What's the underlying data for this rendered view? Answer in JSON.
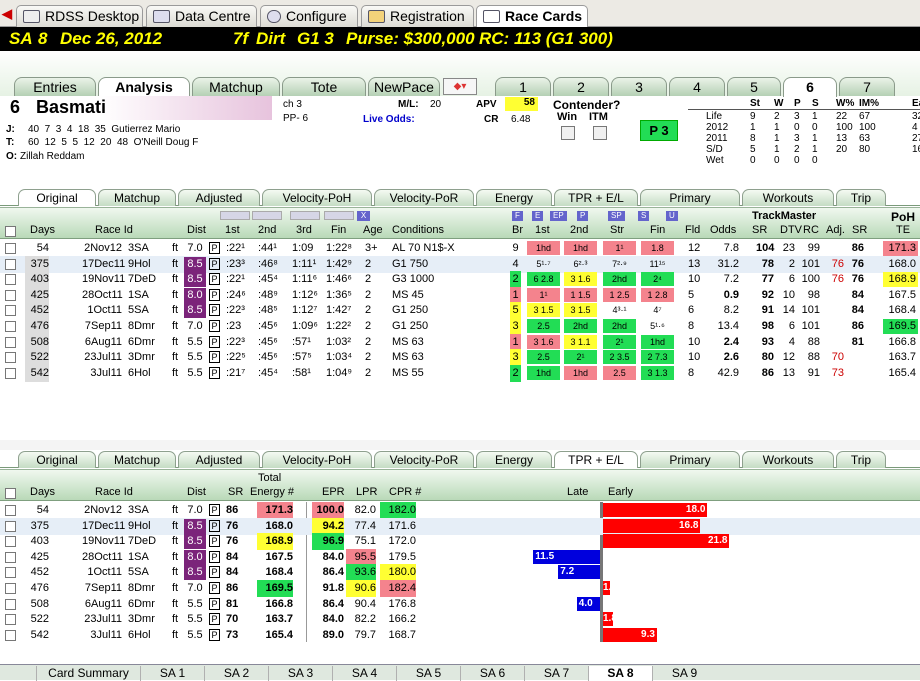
{
  "top_tabs": [
    {
      "label": "RDSS Desktop"
    },
    {
      "label": "Data Centre"
    },
    {
      "label": "Configure"
    },
    {
      "label": "Registration"
    },
    {
      "label": "Race Cards"
    }
  ],
  "race": {
    "track": "SA",
    "num": "8",
    "date": "Dec 26, 2012",
    "dist": "7f",
    "surface": "Dirt",
    "grade": "G1 3",
    "purse": "Purse: $300,000",
    "rc": "RC: 113 (G1 300)"
  },
  "view_tabs": [
    "Entries",
    "Analysis",
    "Matchup",
    "Tote",
    "NewPace"
  ],
  "horse_tabs": [
    "1",
    "2",
    "3",
    "4",
    "5",
    "6",
    "7"
  ],
  "horse": {
    "num": "6",
    "name": "Basmati",
    "ch": "ch 3",
    "pp": "PP- 6",
    "ml_label": "M/L:",
    "ml": "20",
    "live_label": "Live Odds:",
    "apv_label": "APV",
    "apv": "58",
    "cr_label": "CR",
    "cr": "6.48",
    "contender": "Contender?",
    "win": "Win",
    "itm": "ITM",
    "p3": "P 3",
    "j_label": "J:",
    "j": "40  7  3  4  18  35  Gutierrez Mario",
    "t_label": "T:",
    "t": "60  12  5  5  12  20  48  O'Neill Doug F",
    "o_label": "O:",
    "o": "Zillah Reddam"
  },
  "stats": {
    "headers": [
      "St",
      "W",
      "P",
      "S",
      "W%",
      "IM%",
      "Ear"
    ],
    "rows": [
      [
        "Life",
        "9",
        "2",
        "3",
        "1",
        "22",
        "67",
        "32"
      ],
      [
        "2012",
        "1",
        "1",
        "0",
        "0",
        "100",
        "100",
        "4"
      ],
      [
        "2011",
        "8",
        "1",
        "3",
        "1",
        "13",
        "63",
        "27"
      ],
      [
        "S/D",
        "5",
        "1",
        "2",
        "1",
        "20",
        "80",
        "16"
      ],
      [
        "Wet",
        "0",
        "0",
        "0",
        "0",
        "",
        "",
        " "
      ]
    ]
  },
  "sub_tabs": [
    "Original",
    "Matchup",
    "Adjusted",
    "Velocity-PoH",
    "Velocity-PoR",
    "Energy",
    "TPR + E/L",
    "Primary",
    "Workouts",
    "Trip"
  ],
  "pp": {
    "headers": {
      "days": "Days",
      "race_id": "Race Id",
      "dist": "Dist",
      "c1": "1st",
      "c2": "2nd",
      "c3": "3rd",
      "fin": "Fin",
      "age": "Age",
      "cond": "Conditions",
      "br": "Br",
      "f1": "1st",
      "f2": "2nd",
      "str": "Str",
      "ffin": "Fin",
      "fld": "Fld",
      "odds": "Odds",
      "sr": "SR",
      "dtv": "DTV",
      "rc": "RC",
      "adj": "Adj.",
      "sr2": "SR",
      "poh": "PoH",
      "te": "TE",
      "tm": "TrackMaster"
    },
    "rows": [
      {
        "days": "54",
        "date": "2Nov12",
        "trk": "3SA",
        "s": "ft",
        "d": "7.0",
        "c1": ":22¹",
        "c2": ":44¹",
        "c3": "1:09",
        "fin": "1:22⁸",
        "age": "3+",
        "cond": "AL 70 N1$-X",
        "br": "9",
        "f1": "1hd",
        "f2": "1hd",
        "str": "1¹",
        "ffin": "1.8",
        "fld": "12",
        "odds": "7.8",
        "sr": "104",
        "dtv": "23",
        "rc": "99",
        "adj": "",
        "sr2": "86",
        "te": "171.3"
      },
      {
        "days": "375",
        "date": "17Dec11",
        "trk": "9Hol",
        "s": "ft",
        "d": "8.5",
        "c1": ":23³",
        "c2": ":46⁸",
        "c3": "1:11¹",
        "fin": "1:42⁹",
        "age": "2",
        "cond": "G1 750",
        "br": "4",
        "f1": "5¹·⁷",
        "f2": "6²·³",
        "str": "7²·⁹",
        "ffin": "11¹⁵",
        "fld": "13",
        "odds": "31.2",
        "sr": "78",
        "dtv": "2",
        "rc": "101",
        "adj": "76",
        "sr2": "76",
        "te": "168.0"
      },
      {
        "days": "403",
        "date": "19Nov11",
        "trk": "7DeD",
        "s": "ft",
        "d": "8.5",
        "c1": ":22¹",
        "c2": ":45⁴",
        "c3": "1:11⁶",
        "fin": "1:46⁶",
        "age": "2",
        "cond": "G3 1000",
        "br": "2",
        "f1": "6 2.8",
        "f2": "3 1.6",
        "str": "2hd",
        "ffin": "2⁴",
        "fld": "10",
        "odds": "7.2",
        "sr": "77",
        "dtv": "6",
        "rc": "100",
        "adj": "76",
        "sr2": "76",
        "te": "168.9"
      },
      {
        "days": "425",
        "date": "28Oct11",
        "trk": "1SA",
        "s": "ft",
        "d": "8.0",
        "c1": ":24⁶",
        "c2": ":48⁹",
        "c3": "1:12⁶",
        "fin": "1:36⁵",
        "age": "2",
        "cond": "MS 45",
        "br": "1",
        "f1": "1¹",
        "f2": "1 1.5",
        "str": "1 2.5",
        "ffin": "1 2.8",
        "fld": "5",
        "odds": "0.9",
        "sr": "92",
        "dtv": "10",
        "rc": "98",
        "adj": "",
        "sr2": "84",
        "te": "167.5"
      },
      {
        "days": "452",
        "date": "1Oct11",
        "trk": "5SA",
        "s": "ft",
        "d": "8.5",
        "c1": ":22³",
        "c2": ":48⁵",
        "c3": "1:12⁷",
        "fin": "1:42⁷",
        "age": "2",
        "cond": "G1 250",
        "br": "5",
        "f1": "3 1.5",
        "f2": "3 1.5",
        "str": "4³·¹",
        "ffin": "4⁷",
        "fld": "6",
        "odds": "8.2",
        "sr": "91",
        "dtv": "14",
        "rc": "101",
        "adj": "",
        "sr2": "84",
        "te": "168.4"
      },
      {
        "days": "476",
        "date": "7Sep11",
        "trk": "8Dmr",
        "s": "ft",
        "d": "7.0",
        "c1": ":23",
        "c2": ":45⁶",
        "c3": "1:09⁶",
        "fin": "1:22²",
        "age": "2",
        "cond": "G1 250",
        "br": "3",
        "f1": "2.5",
        "f2": "2hd",
        "str": "2hd",
        "ffin": "5¹·⁶",
        "fld": "8",
        "odds": "13.4",
        "sr": "98",
        "dtv": "6",
        "rc": "101",
        "adj": "",
        "sr2": "86",
        "te": "169.5"
      },
      {
        "days": "508",
        "date": "6Aug11",
        "trk": "6Dmr",
        "s": "ft",
        "d": "5.5",
        "c1": ":22³",
        "c2": ":45⁶",
        "c3": ":57¹",
        "fin": "1:03²",
        "age": "2",
        "cond": "MS 63",
        "br": "1",
        "f1": "3 1.6",
        "f2": "3 1.1",
        "str": "2¹",
        "ffin": "1hd",
        "fld": "10",
        "odds": "2.4",
        "sr": "93",
        "dtv": "4",
        "rc": "88",
        "adj": "",
        "sr2": "81",
        "te": "166.8"
      },
      {
        "days": "522",
        "date": "23Jul11",
        "trk": "3Dmr",
        "s": "ft",
        "d": "5.5",
        "c1": ":22⁵",
        "c2": ":45⁶",
        "c3": ":57⁵",
        "fin": "1:03⁴",
        "age": "2",
        "cond": "MS 63",
        "br": "3",
        "f1": "2.5",
        "f2": "2¹",
        "str": "2 3.5",
        "ffin": "2 7.3",
        "fld": "10",
        "odds": "2.6",
        "sr": "80",
        "dtv": "12",
        "rc": "88",
        "adj": "70",
        "sr2": "",
        "te": "163.7"
      },
      {
        "days": "542",
        "date": "3Jul11",
        "trk": "6Hol",
        "s": "ft",
        "d": "5.5",
        "c1": ":21⁷",
        "c2": ":45⁴",
        "c3": ":58¹",
        "fin": "1:04⁹",
        "age": "2",
        "cond": "MS 55",
        "br": "2",
        "f1": "1hd",
        "f2": "1hd",
        "str": "2.5",
        "ffin": "3 1.3",
        "fld": "8",
        "odds": "42.9",
        "sr": "86",
        "dtv": "13",
        "rc": "91",
        "adj": "73",
        "sr2": "",
        "te": "165.4"
      }
    ]
  },
  "tpr": {
    "headers": {
      "days": "Days",
      "race_id": "Race Id",
      "dist": "Dist",
      "sr": "SR",
      "total1": "Total",
      "total2": "Energy #",
      "epr": "EPR",
      "lpr": "LPR",
      "cpr": "CPR #",
      "late": "Late",
      "early": "Early"
    },
    "rows": [
      {
        "days": "54",
        "date": "2Nov12",
        "trk": "3SA",
        "s": "ft",
        "d": "7.0",
        "sr": "86",
        "te": "171.3",
        "epr": "100.0",
        "lpr": "82.0",
        "cpr": "182.0",
        "bar": "18.0"
      },
      {
        "days": "375",
        "date": "17Dec11",
        "trk": "9Hol",
        "s": "ft",
        "d": "8.5",
        "sr": "76",
        "te": "168.0",
        "epr": "94.2",
        "lpr": "77.4",
        "cpr": "171.6",
        "bar": "16.8"
      },
      {
        "days": "403",
        "date": "19Nov11",
        "trk": "7DeD",
        "s": "ft",
        "d": "8.5",
        "sr": "76",
        "te": "168.9",
        "epr": "96.9",
        "lpr": "75.1",
        "cpr": "172.0",
        "bar": "21.8"
      },
      {
        "days": "425",
        "date": "28Oct11",
        "trk": "1SA",
        "s": "ft",
        "d": "8.0",
        "sr": "84",
        "te": "167.5",
        "epr": "84.0",
        "lpr": "95.5",
        "cpr": "179.5",
        "bar": "11.5"
      },
      {
        "days": "452",
        "date": "1Oct11",
        "trk": "5SA",
        "s": "ft",
        "d": "8.5",
        "sr": "84",
        "te": "168.4",
        "epr": "86.4",
        "lpr": "93.6",
        "cpr": "180.0",
        "bar": "7.2"
      },
      {
        "days": "476",
        "date": "7Sep11",
        "trk": "8Dmr",
        "s": "ft",
        "d": "7.0",
        "sr": "86",
        "te": "169.5",
        "epr": "91.8",
        "lpr": "90.6",
        "cpr": "182.4",
        "bar": "1.2"
      },
      {
        "days": "508",
        "date": "6Aug11",
        "trk": "6Dmr",
        "s": "ft",
        "d": "5.5",
        "sr": "81",
        "te": "166.8",
        "epr": "86.4",
        "lpr": "90.4",
        "cpr": "176.8",
        "bar": "4.0"
      },
      {
        "days": "522",
        "date": "23Jul11",
        "trk": "3Dmr",
        "s": "ft",
        "d": "5.5",
        "sr": "70",
        "te": "163.7",
        "epr": "84.0",
        "lpr": "82.2",
        "cpr": "166.2",
        "bar": "1.8"
      },
      {
        "days": "542",
        "date": "3Jul11",
        "trk": "6Hol",
        "s": "ft",
        "d": "5.5",
        "sr": "73",
        "te": "165.4",
        "epr": "89.0",
        "lpr": "79.7",
        "cpr": "168.7",
        "bar": "9.3"
      }
    ]
  },
  "bottom_tabs": [
    "Card Summary",
    "SA 1",
    "SA 2",
    "SA 3",
    "SA 4",
    "SA 5",
    "SA 6",
    "SA 7",
    "SA 8",
    "SA 9"
  ],
  "colors": {
    "early": "#ff0000",
    "late": "#0000dd",
    "purple": "#7b247a"
  }
}
